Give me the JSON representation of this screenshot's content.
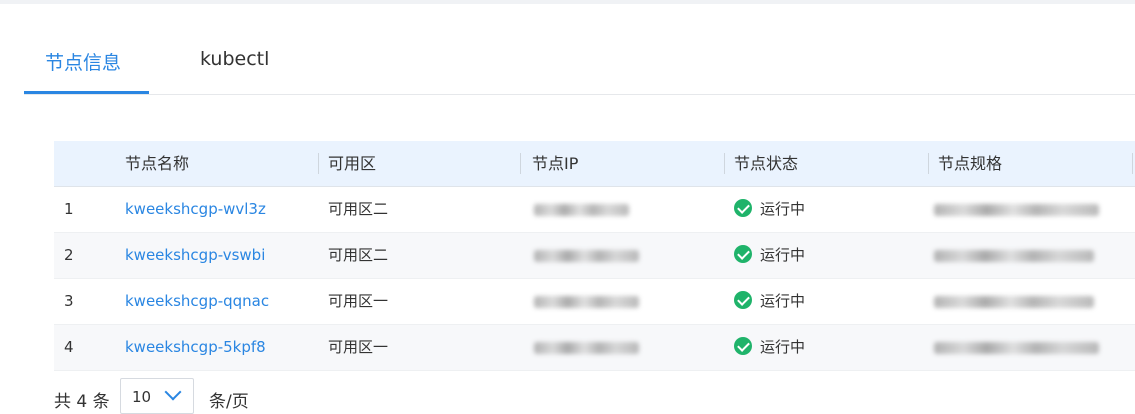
{
  "tabs": [
    {
      "label": "节点信息",
      "active": true
    },
    {
      "label": "kubectl",
      "active": false
    }
  ],
  "table": {
    "columns": [
      "节点名称",
      "可用区",
      "节点IP",
      "节点状态",
      "节点规格"
    ],
    "rows": [
      {
        "index": "1",
        "name": "kweekshcgp-wvl3z",
        "zone": "可用区二",
        "ip": "",
        "status": "运行中",
        "spec": ""
      },
      {
        "index": "2",
        "name": "kweekshcgp-vswbi",
        "zone": "可用区二",
        "ip": "",
        "status": "运行中",
        "spec": ""
      },
      {
        "index": "3",
        "name": "kweekshcgp-qqnac",
        "zone": "可用区一",
        "ip": "",
        "status": "运行中",
        "spec": ""
      },
      {
        "index": "4",
        "name": "kweekshcgp-5kpf8",
        "zone": "可用区一",
        "ip": "",
        "status": "运行中",
        "spec": ""
      }
    ]
  },
  "pagination": {
    "total_label": "共 4 条",
    "page_size": "10",
    "per_page_label": "条/页"
  },
  "colors": {
    "accent": "#2a86e2",
    "status_ok": "#1fb36a",
    "header_bg": "#eaf3fe"
  },
  "icons": {
    "status": "check-circle-icon",
    "dropdown": "chevron-down-icon"
  }
}
